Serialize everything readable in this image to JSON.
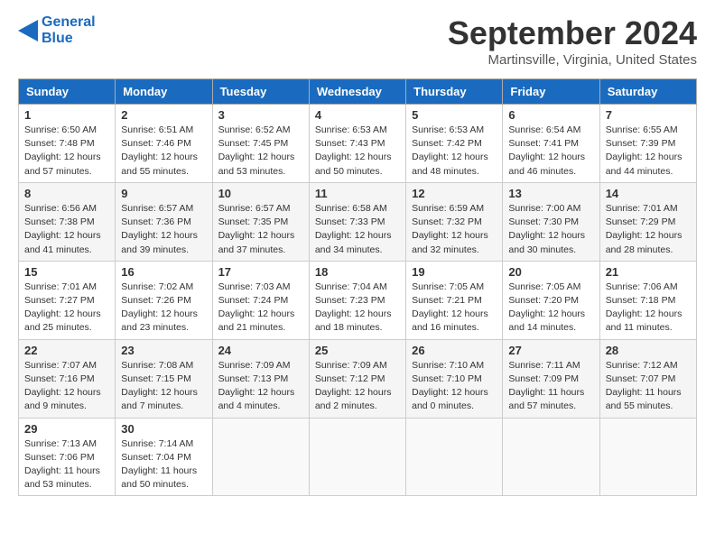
{
  "header": {
    "logo_line1": "General",
    "logo_line2": "Blue",
    "month_title": "September 2024",
    "location": "Martinsville, Virginia, United States"
  },
  "days_of_week": [
    "Sunday",
    "Monday",
    "Tuesday",
    "Wednesday",
    "Thursday",
    "Friday",
    "Saturday"
  ],
  "weeks": [
    [
      {
        "num": "1",
        "rise": "6:50 AM",
        "set": "7:48 PM",
        "hours": "12 hours and 57 minutes."
      },
      {
        "num": "2",
        "rise": "6:51 AM",
        "set": "7:46 PM",
        "hours": "12 hours and 55 minutes."
      },
      {
        "num": "3",
        "rise": "6:52 AM",
        "set": "7:45 PM",
        "hours": "12 hours and 53 minutes."
      },
      {
        "num": "4",
        "rise": "6:53 AM",
        "set": "7:43 PM",
        "hours": "12 hours and 50 minutes."
      },
      {
        "num": "5",
        "rise": "6:53 AM",
        "set": "7:42 PM",
        "hours": "12 hours and 48 minutes."
      },
      {
        "num": "6",
        "rise": "6:54 AM",
        "set": "7:41 PM",
        "hours": "12 hours and 46 minutes."
      },
      {
        "num": "7",
        "rise": "6:55 AM",
        "set": "7:39 PM",
        "hours": "12 hours and 44 minutes."
      }
    ],
    [
      {
        "num": "8",
        "rise": "6:56 AM",
        "set": "7:38 PM",
        "hours": "12 hours and 41 minutes."
      },
      {
        "num": "9",
        "rise": "6:57 AM",
        "set": "7:36 PM",
        "hours": "12 hours and 39 minutes."
      },
      {
        "num": "10",
        "rise": "6:57 AM",
        "set": "7:35 PM",
        "hours": "12 hours and 37 minutes."
      },
      {
        "num": "11",
        "rise": "6:58 AM",
        "set": "7:33 PM",
        "hours": "12 hours and 34 minutes."
      },
      {
        "num": "12",
        "rise": "6:59 AM",
        "set": "7:32 PM",
        "hours": "12 hours and 32 minutes."
      },
      {
        "num": "13",
        "rise": "7:00 AM",
        "set": "7:30 PM",
        "hours": "12 hours and 30 minutes."
      },
      {
        "num": "14",
        "rise": "7:01 AM",
        "set": "7:29 PM",
        "hours": "12 hours and 28 minutes."
      }
    ],
    [
      {
        "num": "15",
        "rise": "7:01 AM",
        "set": "7:27 PM",
        "hours": "12 hours and 25 minutes."
      },
      {
        "num": "16",
        "rise": "7:02 AM",
        "set": "7:26 PM",
        "hours": "12 hours and 23 minutes."
      },
      {
        "num": "17",
        "rise": "7:03 AM",
        "set": "7:24 PM",
        "hours": "12 hours and 21 minutes."
      },
      {
        "num": "18",
        "rise": "7:04 AM",
        "set": "7:23 PM",
        "hours": "12 hours and 18 minutes."
      },
      {
        "num": "19",
        "rise": "7:05 AM",
        "set": "7:21 PM",
        "hours": "12 hours and 16 minutes."
      },
      {
        "num": "20",
        "rise": "7:05 AM",
        "set": "7:20 PM",
        "hours": "12 hours and 14 minutes."
      },
      {
        "num": "21",
        "rise": "7:06 AM",
        "set": "7:18 PM",
        "hours": "12 hours and 11 minutes."
      }
    ],
    [
      {
        "num": "22",
        "rise": "7:07 AM",
        "set": "7:16 PM",
        "hours": "12 hours and 9 minutes."
      },
      {
        "num": "23",
        "rise": "7:08 AM",
        "set": "7:15 PM",
        "hours": "12 hours and 7 minutes."
      },
      {
        "num": "24",
        "rise": "7:09 AM",
        "set": "7:13 PM",
        "hours": "12 hours and 4 minutes."
      },
      {
        "num": "25",
        "rise": "7:09 AM",
        "set": "7:12 PM",
        "hours": "12 hours and 2 minutes."
      },
      {
        "num": "26",
        "rise": "7:10 AM",
        "set": "7:10 PM",
        "hours": "12 hours and 0 minutes."
      },
      {
        "num": "27",
        "rise": "7:11 AM",
        "set": "7:09 PM",
        "hours": "11 hours and 57 minutes."
      },
      {
        "num": "28",
        "rise": "7:12 AM",
        "set": "7:07 PM",
        "hours": "11 hours and 55 minutes."
      }
    ],
    [
      {
        "num": "29",
        "rise": "7:13 AM",
        "set": "7:06 PM",
        "hours": "11 hours and 53 minutes."
      },
      {
        "num": "30",
        "rise": "7:14 AM",
        "set": "7:04 PM",
        "hours": "11 hours and 50 minutes."
      },
      null,
      null,
      null,
      null,
      null
    ]
  ],
  "labels": {
    "sunrise": "Sunrise:",
    "sunset": "Sunset:",
    "daylight": "Daylight:"
  }
}
